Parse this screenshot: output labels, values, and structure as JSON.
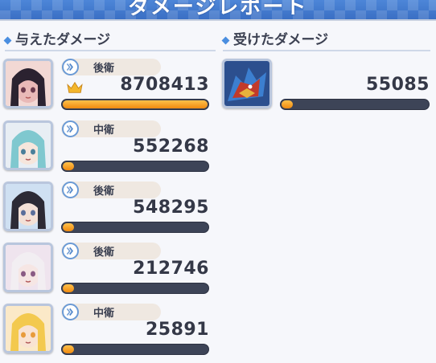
{
  "header": {
    "title": "ダメージレポート"
  },
  "sections": {
    "dealt": "与えたダメージ",
    "taken": "受けたダメージ"
  },
  "dealt_rows": [
    {
      "role": "後衛",
      "damage": "8708413",
      "fill": 1.0,
      "top_damage": true,
      "portrait": "dark-hair-catgirl-portrait"
    },
    {
      "role": "中衛",
      "damage": "552268",
      "fill": 0.063,
      "top_damage": false,
      "portrait": "teal-hair-portrait"
    },
    {
      "role": "後衛",
      "damage": "548295",
      "fill": 0.063,
      "top_damage": false,
      "portrait": "dark-hair-blue-portrait"
    },
    {
      "role": "後衛",
      "damage": "212746",
      "fill": 0.025,
      "top_damage": false,
      "portrait": "white-hair-portrait"
    },
    {
      "role": "中衛",
      "damage": "25891",
      "fill": 0.01,
      "top_damage": false,
      "portrait": "blonde-hair-portrait"
    }
  ],
  "taken_rows": [
    {
      "damage": "55085",
      "fill": 0.03,
      "portrait": "dragon-boss-portrait"
    }
  ],
  "colors": {
    "bar_fill": "#f59a1c",
    "bar_track": "#3d4457",
    "header": "#3f76cc",
    "accent": "#4a8ee0"
  }
}
